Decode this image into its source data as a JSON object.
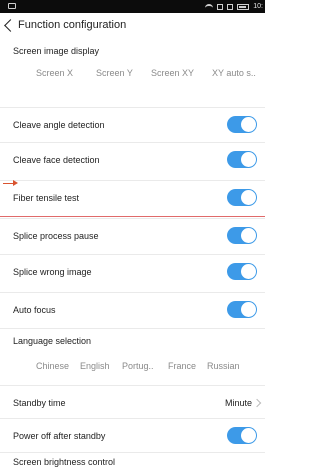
{
  "status_bar": {
    "time": "10:"
  },
  "header": {
    "title": "Function configuration"
  },
  "screen_image_display": {
    "label": "Screen image display",
    "options": [
      "Screen X",
      "Screen Y",
      "Screen XY",
      "XY auto s.."
    ]
  },
  "toggles": [
    {
      "label": "Cleave angle detection",
      "on": true
    },
    {
      "label": "Cleave face detection",
      "on": true
    },
    {
      "label": "Fiber tensile test",
      "on": true
    },
    {
      "label": "Splice process pause",
      "on": true
    },
    {
      "label": "Splice wrong image",
      "on": true
    },
    {
      "label": "Auto focus",
      "on": true
    }
  ],
  "language_selection": {
    "label": "Language selection",
    "options": [
      "Chinese",
      "English",
      "Portug..",
      "France",
      "Russian"
    ]
  },
  "standby_time": {
    "label": "Standby time",
    "value": "Minute"
  },
  "power_off": {
    "label": "Power off after standby",
    "on": true
  },
  "screen_brightness": {
    "label": "Screen brightness control"
  },
  "colors": {
    "accent": "#3d9ae8",
    "annotation": "#d9532f"
  }
}
